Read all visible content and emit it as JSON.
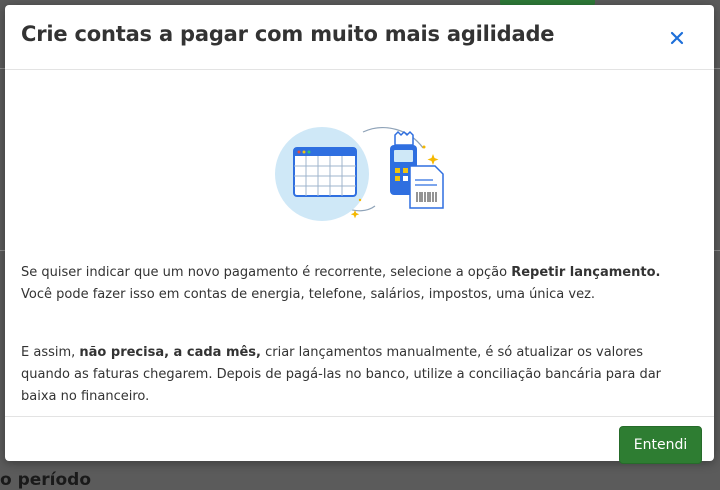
{
  "modal": {
    "title": "Crie contas a pagar com muito mais agilidade",
    "paragraph1": {
      "before": "Se quiser indicar que um novo pagamento é recorrente, selecione a opção ",
      "bold": "Repetir lançamento.",
      "after": " Você pode fazer isso em contas de energia, telefone, salários, impostos, uma única vez."
    },
    "paragraph2": {
      "before": "E assim, ",
      "bold": "não precisa, a cada mês,",
      "after": " criar lançamentos manualmente, é só atualizar os valores quando as faturas chegarem. Depois de pagá-las no banco, utilize a conciliação bancária para dar baixa no financeiro."
    },
    "confirm_label": "Entendi"
  },
  "background": {
    "partial_text": "o período"
  },
  "colors": {
    "primary_button": "#2e7d32",
    "close_icon": "#1e6fd9",
    "illustration_blue": "#2f6fe0"
  },
  "icons": [
    "close-icon",
    "calendar-illustration",
    "card-machine-illustration",
    "invoice-illustration"
  ]
}
